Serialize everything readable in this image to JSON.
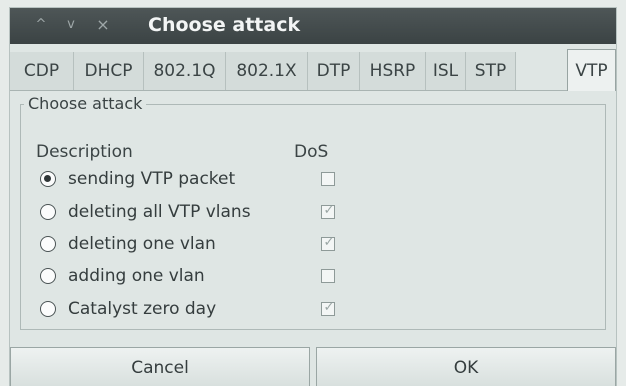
{
  "window": {
    "title": "Choose attack",
    "controls": [
      "^",
      "v",
      "×"
    ]
  },
  "tabs": [
    {
      "label": "CDP",
      "active": false
    },
    {
      "label": "DHCP",
      "active": false
    },
    {
      "label": "802.1Q",
      "active": false
    },
    {
      "label": "802.1X",
      "active": false
    },
    {
      "label": "DTP",
      "active": false
    },
    {
      "label": "HSRP",
      "active": false
    },
    {
      "label": "ISL",
      "active": false
    },
    {
      "label": "STP",
      "active": false
    },
    {
      "label": "VTP",
      "active": true
    }
  ],
  "group": {
    "title": "Choose attack",
    "col_description": "Description",
    "col_dos": "DoS"
  },
  "attacks": [
    {
      "label": "sending VTP packet",
      "selected": true,
      "dos": false
    },
    {
      "label": "deleting all VTP vlans",
      "selected": false,
      "dos": true
    },
    {
      "label": "deleting one vlan",
      "selected": false,
      "dos": true
    },
    {
      "label": "adding one vlan",
      "selected": false,
      "dos": false
    },
    {
      "label": "Catalyst zero day",
      "selected": false,
      "dos": true
    }
  ],
  "buttons": {
    "cancel": "Cancel",
    "ok": "OK"
  },
  "colors": {
    "titlebar": "#3b4344",
    "window_bg": "#dfe6e4"
  }
}
